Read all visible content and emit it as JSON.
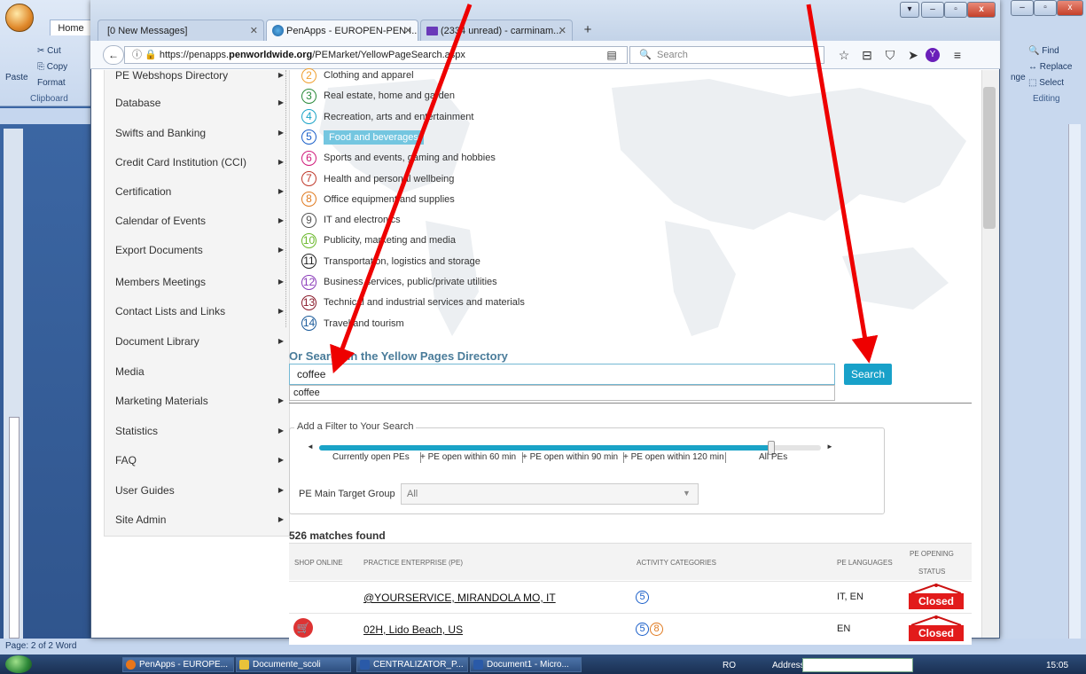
{
  "word": {
    "home_tab": "Home",
    "clipboard": {
      "cut": "Cut",
      "copy": "Copy",
      "paste": "Paste",
      "format": "Format",
      "label": "Clipboard"
    },
    "editing": {
      "find": "Find",
      "replace": "Replace",
      "select": "Select",
      "label": "Editing",
      "change": "nge"
    },
    "status": "Page: 2 of 2   Word"
  },
  "browser": {
    "tabs": [
      {
        "label": "[0 New Messages]"
      },
      {
        "label": "PenApps - EUROPEN-PEN I..."
      },
      {
        "label": "(2334 unread) - carminam..."
      }
    ],
    "url_prefix": "https://penapps.",
    "url_host": "penworldwide.org",
    "url_path": "/PEMarket/YellowPageSearch.aspx",
    "search_placeholder": "Search"
  },
  "menu": {
    "items": [
      "PE Webshops Directory",
      "Database",
      "Swifts and Banking",
      "Credit Card Institution (CCI)",
      "Certification",
      "Calendar of Events",
      "Export Documents",
      "Members Meetings",
      "Contact Lists and Links",
      "Document Library",
      "Media",
      "Marketing Materials",
      "Statistics",
      "FAQ",
      "User Guides",
      "Site Admin"
    ]
  },
  "categories": [
    {
      "num": "2",
      "label": "Clothing and apparel",
      "color": "#f0a030"
    },
    {
      "num": "3",
      "label": "Real estate, home and garden",
      "color": "#2a8a3a"
    },
    {
      "num": "4",
      "label": "Recreation, arts and entertainment",
      "color": "#1aa3c7"
    },
    {
      "num": "5",
      "label": "Food and beverages",
      "color": "#1a5fc9"
    },
    {
      "num": "6",
      "label": "Sports and events, gaming and hobbies",
      "color": "#d01a7a"
    },
    {
      "num": "7",
      "label": "Health and personal wellbeing",
      "color": "#c0392b"
    },
    {
      "num": "8",
      "label": "Office equipment and supplies",
      "color": "#e07a20"
    },
    {
      "num": "9",
      "label": "IT and electronics",
      "color": "#555555"
    },
    {
      "num": "10",
      "label": "Publicity, marketing and media",
      "color": "#6ab82a"
    },
    {
      "num": "11",
      "label": "Transportation, logistics and storage",
      "color": "#222222"
    },
    {
      "num": "12",
      "label": "Business services, public/private utilities",
      "color": "#8a3ab9"
    },
    {
      "num": "13",
      "label": "Technical and industrial services and materials",
      "color": "#8a1a2a"
    },
    {
      "num": "14",
      "label": "Travel and tourism",
      "color": "#1a5a9a"
    }
  ],
  "search": {
    "heading": "Or Search in the Yellow Pages Directory",
    "value": "coffee",
    "suggestion": "coffee",
    "button": "Search"
  },
  "filter": {
    "title": "Add a Filter to Your Search",
    "ticks": [
      "Currently open PEs",
      "+ PE open within 60 min",
      "+ PE open within 90 min",
      "+ PE open within 120 min",
      "All PEs"
    ],
    "slider_level": 0.9,
    "target_group_label": "PE Main Target Group",
    "target_group_value": "All"
  },
  "results": {
    "count_text": "526 matches found",
    "headers": {
      "shop_online": "SHOP ONLINE",
      "pe": "PRACTICE ENTERPRISE (PE)",
      "activity": "ACTIVITY CATEGORIES",
      "languages": "PE LANGUAGES",
      "opening1": "PE OPENING",
      "opening2": "STATUS"
    },
    "rows": [
      {
        "name": "@YOURSERVICE, MIRANDOLA MO, IT",
        "categories": [
          "5"
        ],
        "languages": "IT, EN",
        "status": "Closed",
        "shop": false
      },
      {
        "name": "02H, Lido Beach, US",
        "categories": [
          "5",
          "8"
        ],
        "languages": "EN",
        "status": "Closed",
        "shop": true
      }
    ]
  },
  "taskbar": {
    "items": [
      "PenApps - EUROPE...",
      "Documente_scoli",
      "CENTRALIZATOR_P...",
      "Document1 - Micro..."
    ],
    "lang": "RO",
    "address_label": "Address",
    "clock": "15:05"
  },
  "colors": {
    "accent": "#18a1c9",
    "closed": "#e21b1b",
    "arrow": "#ee0000"
  }
}
